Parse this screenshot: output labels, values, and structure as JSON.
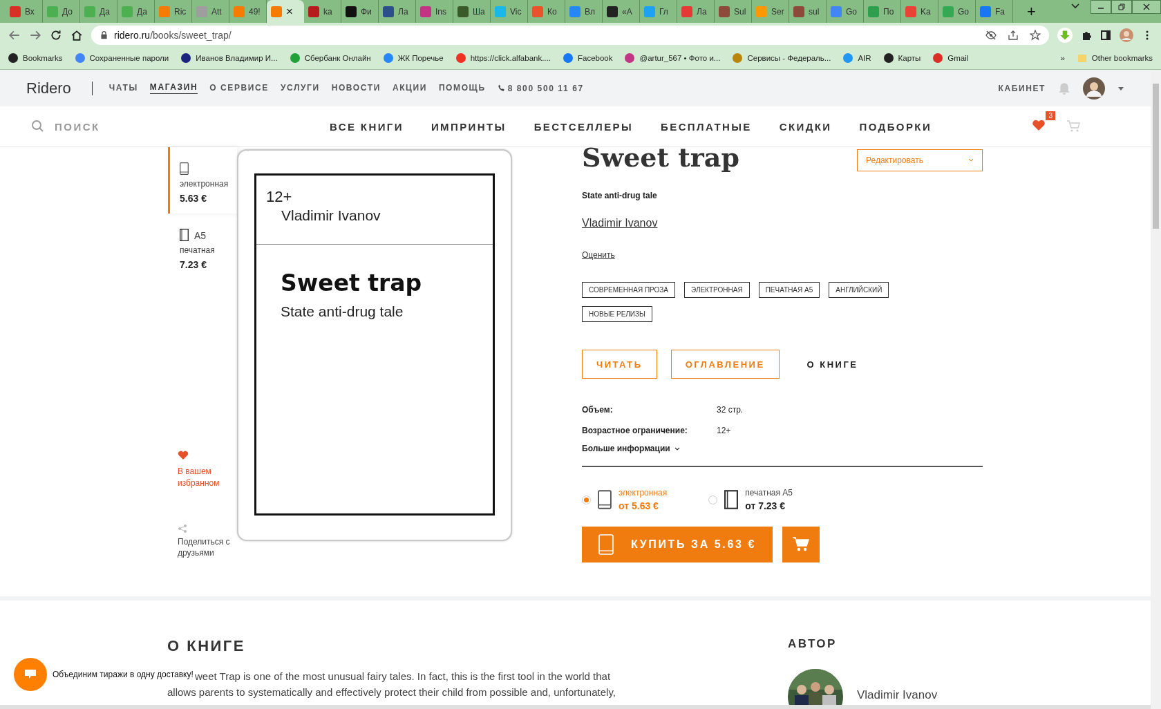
{
  "browser": {
    "tabs": [
      {
        "label": "Вх",
        "color": "#d93025",
        "selected": false
      },
      {
        "label": "До",
        "color": "#4caf50",
        "selected": false
      },
      {
        "label": "Да",
        "color": "#4caf50",
        "selected": false
      },
      {
        "label": "Да",
        "color": "#4caf50",
        "selected": false
      },
      {
        "label": "Ric",
        "color": "#f57c00",
        "selected": false
      },
      {
        "label": "Att",
        "color": "#9e9e9e",
        "selected": false
      },
      {
        "label": "49!",
        "color": "#f57c00",
        "selected": false
      },
      {
        "label": "×",
        "color": "#f57c00",
        "selected": true
      },
      {
        "label": "ka",
        "color": "#b71c1c",
        "selected": false
      },
      {
        "label": "Фи",
        "color": "#111111",
        "selected": false
      },
      {
        "label": "Ла",
        "color": "#2c4f8c",
        "selected": false
      },
      {
        "label": "Ins",
        "color": "#c13584",
        "selected": false
      },
      {
        "label": "Ша",
        "color": "#3a5a2a",
        "selected": false
      },
      {
        "label": "Vic",
        "color": "#1ab7ea",
        "selected": false
      },
      {
        "label": "Ко",
        "color": "#e8532b",
        "selected": false
      },
      {
        "label": "Вл",
        "color": "#2787f5",
        "selected": false
      },
      {
        "label": "«А",
        "color": "#222222",
        "selected": false
      },
      {
        "label": "Гл",
        "color": "#1da1f2",
        "selected": false
      },
      {
        "label": "Ла",
        "color": "#e53935",
        "selected": false
      },
      {
        "label": "Sul",
        "color": "#8d4a3a",
        "selected": false
      },
      {
        "label": "Ser",
        "color": "#ff9800",
        "selected": false
      },
      {
        "label": "sul",
        "color": "#8d4a3a",
        "selected": false
      },
      {
        "label": "Go",
        "color": "#4285f4",
        "selected": false
      },
      {
        "label": "По",
        "color": "#2e9e4f",
        "selected": false
      },
      {
        "label": "Ka",
        "color": "#ea4335",
        "selected": false
      },
      {
        "label": "Go",
        "color": "#34a853",
        "selected": false
      },
      {
        "label": "Fa",
        "color": "#1877f2",
        "selected": false
      }
    ],
    "new_tab": "+",
    "address": {
      "host": "ridero.ru",
      "path": "/books/sweet_trap/"
    },
    "bookmarks": [
      {
        "label": "Bookmarks",
        "color": "#222222"
      },
      {
        "label": "Сохраненные пароли",
        "color": "#4285f4"
      },
      {
        "label": "Иванов Владимир И...",
        "color": "#1a237e"
      },
      {
        "label": "Сбербанк Онлайн",
        "color": "#21a038"
      },
      {
        "label": "ЖК Поречье",
        "color": "#2787f5"
      },
      {
        "label": "https://click.alfabank....",
        "color": "#ef3124"
      },
      {
        "label": "Facebook",
        "color": "#1877f2"
      },
      {
        "label": "@artur_567 • Фото и...",
        "color": "#c13584"
      },
      {
        "label": "Сервисы - Федераль...",
        "color": "#b8860b"
      },
      {
        "label": "AIR",
        "color": "#2196f3"
      },
      {
        "label": "Карты",
        "color": "#222222"
      },
      {
        "label": "Gmail",
        "color": "#d93025"
      }
    ],
    "bookmarks_more": "»",
    "other_bookmarks": "Other bookmarks"
  },
  "site_header": {
    "logo": "Ridero",
    "nav": [
      {
        "label": "ЧАТЫ",
        "selected": false
      },
      {
        "label": "МАГАЗИН",
        "selected": true
      },
      {
        "label": "О СЕРВИСЕ",
        "selected": false
      },
      {
        "label": "УСЛУГИ",
        "selected": false
      },
      {
        "label": "НОВОСТИ",
        "selected": false
      },
      {
        "label": "АКЦИИ",
        "selected": false
      },
      {
        "label": "ПОМОЩЬ",
        "selected": false
      }
    ],
    "phone": "8 800 500 11 67",
    "cabinet": "КАБИНЕТ"
  },
  "shop_nav": {
    "search_placeholder": "ПОИСК",
    "items": [
      "ВСЕ КНИГИ",
      "ИМПРИНТЫ",
      "БЕСТСЕЛЛЕРЫ",
      "БЕСПЛАТНЫЕ",
      "СКИДКИ",
      "ПОДБОРКИ"
    ],
    "favorites_count": "3"
  },
  "formats": [
    {
      "kind": "ebook",
      "label": "электронная",
      "price": "5.63 €",
      "selected": true
    },
    {
      "kind": "print",
      "size": "A5",
      "label": "печатная",
      "price": "7.23 €",
      "selected": false
    }
  ],
  "favorite": {
    "label": "В вашем избранном"
  },
  "share": {
    "label": "Поделиться с друзьями"
  },
  "cover": {
    "age": "12+",
    "author": "Vladimir Ivanov",
    "title": "Sweet trap",
    "subtitle": "State anti-drug tale"
  },
  "book": {
    "title": "Sweet trap",
    "edit": "Редактировать",
    "subtitle": "State anti-drug tale",
    "author": "Vladimir Ivanov",
    "rate": "Оценить",
    "tags": [
      "СОВРЕМЕННАЯ ПРОЗА",
      "ЭЛЕКТРОННАЯ",
      "ПЕЧАТНАЯ А5",
      "АНГЛИЙСКИЙ",
      "НОВЫЕ РЕЛИЗЫ"
    ],
    "actions": [
      {
        "label": "ЧИТАТЬ",
        "kind": "outline"
      },
      {
        "label": "ОГЛАВЛЕНИЕ",
        "kind": "outline"
      },
      {
        "label": "О КНИГЕ",
        "kind": "text"
      }
    ],
    "details": [
      {
        "label": "Объем:",
        "value": "32 стр."
      },
      {
        "label": "Возрастное ограничение:",
        "value": "12+"
      }
    ],
    "more_info": "Больше информации",
    "options": [
      {
        "kind": "ebook",
        "label": "электронная",
        "price": "от 5.63 €",
        "selected": true
      },
      {
        "kind": "print",
        "label": "печатная А5",
        "price": "от 7.23 €",
        "selected": false
      }
    ],
    "buy": "КУПИТЬ ЗА 5.63 €"
  },
  "about": {
    "heading": "О КНИГЕ",
    "lines": [
      "weet Trap is one of the most unusual fairy tales. In fact, this is the first tool in the world that",
      "allows parents to systematically and effectively protect their child from possible and, unfortunately,"
    ]
  },
  "author_section": {
    "heading": "АВТОР",
    "name": "Vladimir Ivanov"
  },
  "chat": {
    "banner": "Объединим тиражи в одну доставку!"
  }
}
